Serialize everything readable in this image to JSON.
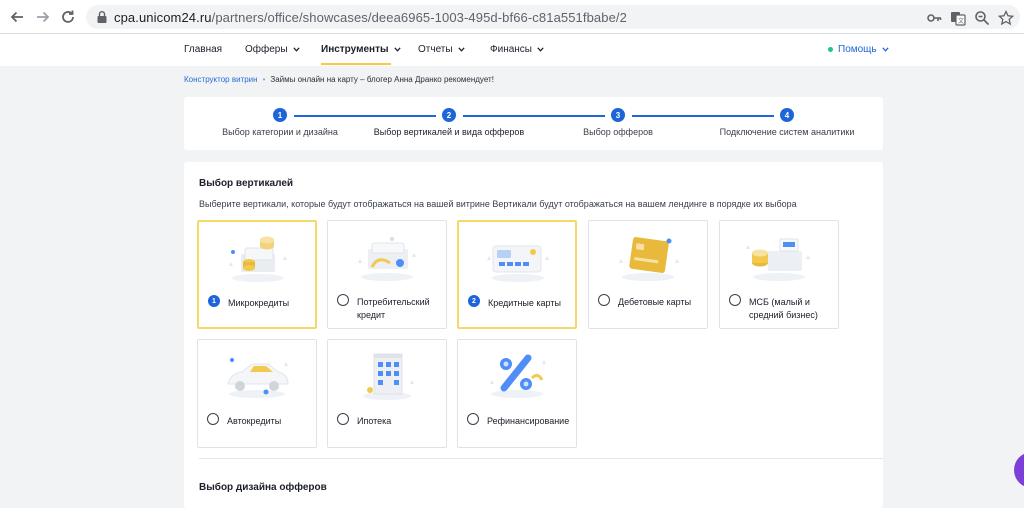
{
  "browser": {
    "url_host": "cpa.unicom24.ru",
    "url_path": "/partners/office/showcases/deea6965-1003-495d-bf66-c81a551fbabe/2"
  },
  "topnav": {
    "items": [
      {
        "label": "Главная"
      },
      {
        "label": "Офферы"
      },
      {
        "label": "Инструменты"
      },
      {
        "label": "Отчеты"
      },
      {
        "label": "Финансы"
      }
    ],
    "help_label": "Помощь"
  },
  "breadcrumb": {
    "link": "Конструктор витрин",
    "separator": "•",
    "current": "Займы онлайн на карту – блогер Анна Дранко рекомендует!"
  },
  "stepper": {
    "steps": [
      {
        "number": "1",
        "label": "Выбор категории и дизайна"
      },
      {
        "number": "2",
        "label": "Выбор вертикалей и вида офферов"
      },
      {
        "number": "3",
        "label": "Выбор офферов"
      },
      {
        "number": "4",
        "label": "Подключение систем аналитики"
      }
    ]
  },
  "verticals": {
    "title": "Выбор вертикалей",
    "description": "Выберите вертикали, которые будут отображаться на вашей витрине Вертикали будут отображаться на вашем лендинге в порядке их выбора",
    "tiles": [
      {
        "label": "Микрокредиты",
        "icon": "coins-stack-icon",
        "order": "1"
      },
      {
        "label": "Потребительский кредит",
        "icon": "consumer-credit-icon",
        "order": ""
      },
      {
        "label": "Кредитные карты",
        "icon": "credit-card-icon",
        "order": "2"
      },
      {
        "label": "Дебетовые карты",
        "icon": "debit-card-icon",
        "order": ""
      },
      {
        "label": "МСБ (малый и средний бизнес)",
        "icon": "cash-register-icon",
        "order": ""
      },
      {
        "label": "Автокредиты",
        "icon": "car-icon",
        "order": ""
      },
      {
        "label": "Ипотека",
        "icon": "building-icon",
        "order": ""
      },
      {
        "label": "Рефинансирование",
        "icon": "percent-icon",
        "order": ""
      }
    ]
  },
  "design": {
    "title": "Выбор дизайна офферов"
  },
  "colors": {
    "accent_blue": "#1d65d8",
    "selected_border": "#f5d86a",
    "active_underline": "#f7c948",
    "help_status_dot": "#26c281",
    "widget_purple": "#7d3fd9"
  }
}
